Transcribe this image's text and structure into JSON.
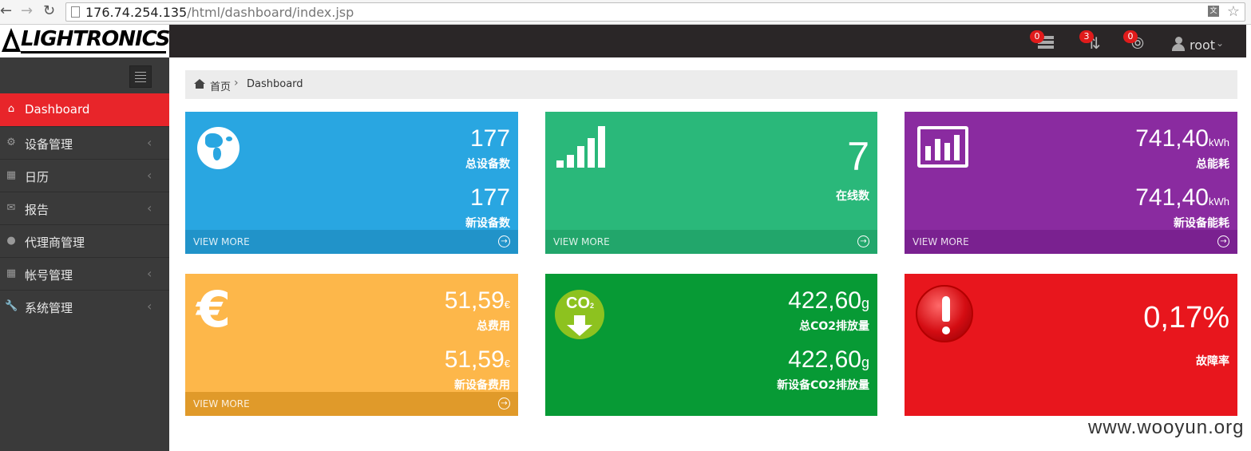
{
  "browser": {
    "url_host": "176.74.254.135",
    "url_path": "/html/dashboard/index.jsp"
  },
  "header": {
    "logo_text": "LIGHTRONICS",
    "notifications": [
      {
        "icon": "server-stack-icon",
        "count": "0"
      },
      {
        "icon": "retweet-icon",
        "count": "3"
      },
      {
        "icon": "upload-circle-icon",
        "count": "0"
      }
    ],
    "user_name": "root"
  },
  "sidebar": {
    "items": [
      {
        "label": "Dashboard",
        "icon": "home-icon",
        "active": true
      },
      {
        "label": "设备管理",
        "icon": "cogs-icon"
      },
      {
        "label": "日历",
        "icon": "table-icon"
      },
      {
        "label": "报告",
        "icon": "envelope-icon"
      },
      {
        "label": "代理商管理",
        "icon": "users-icon"
      },
      {
        "label": "帐号管理",
        "icon": "sitemap-icon"
      },
      {
        "label": "系统管理",
        "icon": "wrench-icon"
      }
    ]
  },
  "breadcrumb": {
    "home": "首页",
    "current": "Dashboard"
  },
  "tiles": {
    "devices": {
      "total_value": "177",
      "total_label": "总设备数",
      "new_value": "177",
      "new_label": "新设备数",
      "more": "VIEW MORE",
      "color": "#29a6e1"
    },
    "online": {
      "value": "7",
      "label": "在线数",
      "more": "VIEW MORE",
      "color": "#2ab87a"
    },
    "energy": {
      "total_value": "741,40",
      "total_unit": "kWh",
      "total_label": "总能耗",
      "new_value": "741,40",
      "new_unit": "kWh",
      "new_label": "新设备能耗",
      "more": "VIEW MORE",
      "color": "#8a2ba0"
    },
    "cost": {
      "total_value": "51,59",
      "total_unit": "€",
      "total_label": "总费用",
      "new_value": "51,59",
      "new_unit": "€",
      "new_label": "新设备费用",
      "more": "VIEW MORE",
      "color": "#fdb74a"
    },
    "co2": {
      "icon_text": "CO",
      "icon_sub": "2",
      "total_value": "422,60",
      "total_unit": "g",
      "total_label": "总CO2排放量",
      "new_value": "422,60",
      "new_unit": "g",
      "new_label": "新设备CO2排放量",
      "color": "#079a35"
    },
    "failure": {
      "value": "0,17%",
      "label": "故障率",
      "color": "#e8161d"
    }
  },
  "watermark": "www.wooyun.org"
}
